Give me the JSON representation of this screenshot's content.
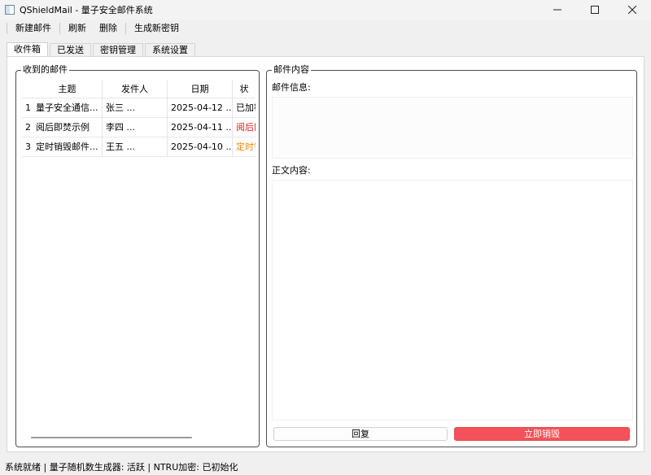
{
  "window": {
    "title": "QShieldMail - 量子安全邮件系统"
  },
  "toolbar": {
    "new_mail": "新建邮件",
    "refresh": "刷新",
    "delete": "删除",
    "gen_key": "生成新密钥"
  },
  "tabs": [
    {
      "label": "收件箱",
      "active": true
    },
    {
      "label": "已发送",
      "active": false
    },
    {
      "label": "密钥管理",
      "active": false
    },
    {
      "label": "系统设置",
      "active": false
    }
  ],
  "inbox": {
    "group_title": "收到的邮件",
    "columns": [
      "主题",
      "发件人",
      "日期",
      "状"
    ],
    "rows": [
      {
        "num": "1",
        "subject": "量子安全通信...",
        "from": "张三 ...",
        "date": "2025-04-12 ...",
        "status": "已加密",
        "status_color": "#000000"
      },
      {
        "num": "2",
        "subject": "阅后即焚示例",
        "from": "李四 ...",
        "date": "2025-04-11 ...",
        "status": "阅后即焚",
        "status_color": "#e01818"
      },
      {
        "num": "3",
        "subject": "定时销毁邮件...",
        "from": "王五 ...",
        "date": "2025-04-10 ...",
        "status": "定时销毁",
        "status_color": "#f08a00"
      }
    ]
  },
  "content": {
    "group_title": "邮件内容",
    "info_label": "邮件信息:",
    "info_text": "",
    "body_label": "正文内容:",
    "body_text": "",
    "reply_button": "回复",
    "destroy_button": "立即销毁",
    "destroy_color": "#f4525a"
  },
  "status_bar": {
    "text": "系统就绪 | 量子随机数生成器: 活跃 | NTRU加密: 已初始化"
  }
}
